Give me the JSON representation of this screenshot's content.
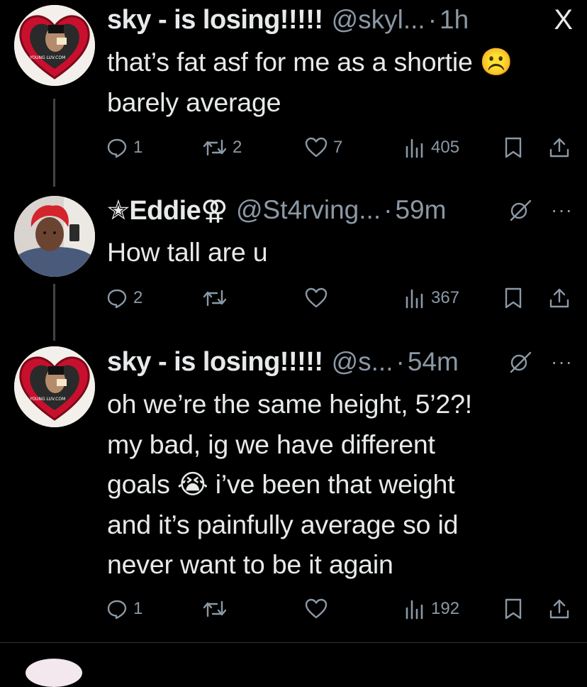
{
  "tweets": [
    {
      "name": "sky - is losing!!!!!",
      "handle": "@skyl...",
      "dot": "·",
      "time": "1h",
      "text": "that’s fat asf for me as a shortie ☹️\nbarely average",
      "replies": "1",
      "reposts": "2",
      "likes": "7",
      "views": "405",
      "avatar_text": "YOUNG LUV.COM"
    },
    {
      "name": "✭Eddie⚢",
      "handle": "@St4rving...",
      "dot": "·",
      "time": "59m",
      "text": "How tall are u",
      "replies": "2",
      "reposts": "",
      "likes": "",
      "views": "367"
    },
    {
      "name": "sky - is losing!!!!!",
      "handle": "@s...",
      "dot": "·",
      "time": "54m",
      "text": "oh we’re the same height, 5’2?!\nmy bad, ig we have different\ngoals 😭 i’ve been that weight\nand it’s painfully average so id\nnever want to be it again",
      "replies": "1",
      "reposts": "",
      "likes": "",
      "views": "192",
      "avatar_text": "YOUNG LUV.COM"
    }
  ],
  "close_icon": "X",
  "more_icon": "···",
  "colors": {
    "background": "#000000",
    "text": "#e7e9ea",
    "muted": "#8b98a5",
    "line": "#444444",
    "heart_red": "#c8102e"
  }
}
